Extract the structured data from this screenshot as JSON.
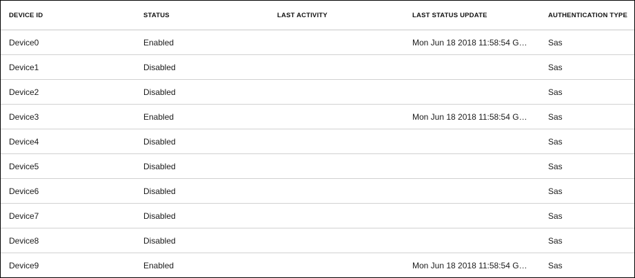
{
  "table": {
    "columns": [
      "DEVICE ID",
      "STATUS",
      "LAST ACTIVITY",
      "LAST STATUS UPDATE",
      "AUTHENTICATION TYPE"
    ],
    "rows": [
      [
        "Device0",
        "Enabled",
        "",
        "Mon Jun 18 2018 11:58:54 GMT-...",
        "Sas"
      ],
      [
        "Device1",
        "Disabled",
        "",
        "",
        "Sas"
      ],
      [
        "Device2",
        "Disabled",
        "",
        "",
        "Sas"
      ],
      [
        "Device3",
        "Enabled",
        "",
        "Mon Jun 18 2018 11:58:54 GMT-...",
        "Sas"
      ],
      [
        "Device4",
        "Disabled",
        "",
        "",
        "Sas"
      ],
      [
        "Device5",
        "Disabled",
        "",
        "",
        "Sas"
      ],
      [
        "Device6",
        "Disabled",
        "",
        "",
        "Sas"
      ],
      [
        "Device7",
        "Disabled",
        "",
        "",
        "Sas"
      ],
      [
        "Device8",
        "Disabled",
        "",
        "",
        "Sas"
      ],
      [
        "Device9",
        "Enabled",
        "",
        "Mon Jun 18 2018 11:58:54 GMT-...",
        "Sas"
      ]
    ]
  }
}
